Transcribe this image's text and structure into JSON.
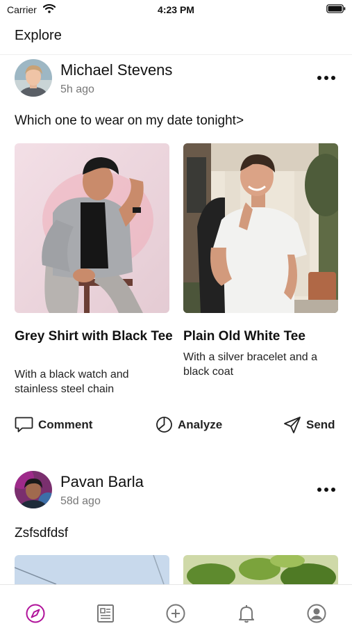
{
  "status_bar": {
    "carrier": "Carrier",
    "time": "4:23 PM"
  },
  "header": {
    "title": "Explore"
  },
  "posts": [
    {
      "author": "Michael Stevens",
      "time": "5h ago",
      "text": "Which one to wear on my date tonight>",
      "options": [
        {
          "title": "Grey Shirt with Black Tee",
          "description": "With a black watch and stainless steel chain"
        },
        {
          "title": "Plain Old White Tee",
          "description": "With a silver bracelet and a black coat"
        }
      ],
      "actions": {
        "comment": "Comment",
        "analyze": "Analyze",
        "send": "Send"
      }
    },
    {
      "author": "Pavan Barla",
      "time": "58d ago",
      "text": "Zsfsdfdsf"
    }
  ],
  "tab_bar": {
    "items": [
      "compass-icon",
      "newspaper-icon",
      "plus-circle-icon",
      "bell-icon",
      "user-circle-icon"
    ],
    "active_index": 0,
    "active_color": "#b0129a",
    "inactive_color": "#777777"
  }
}
